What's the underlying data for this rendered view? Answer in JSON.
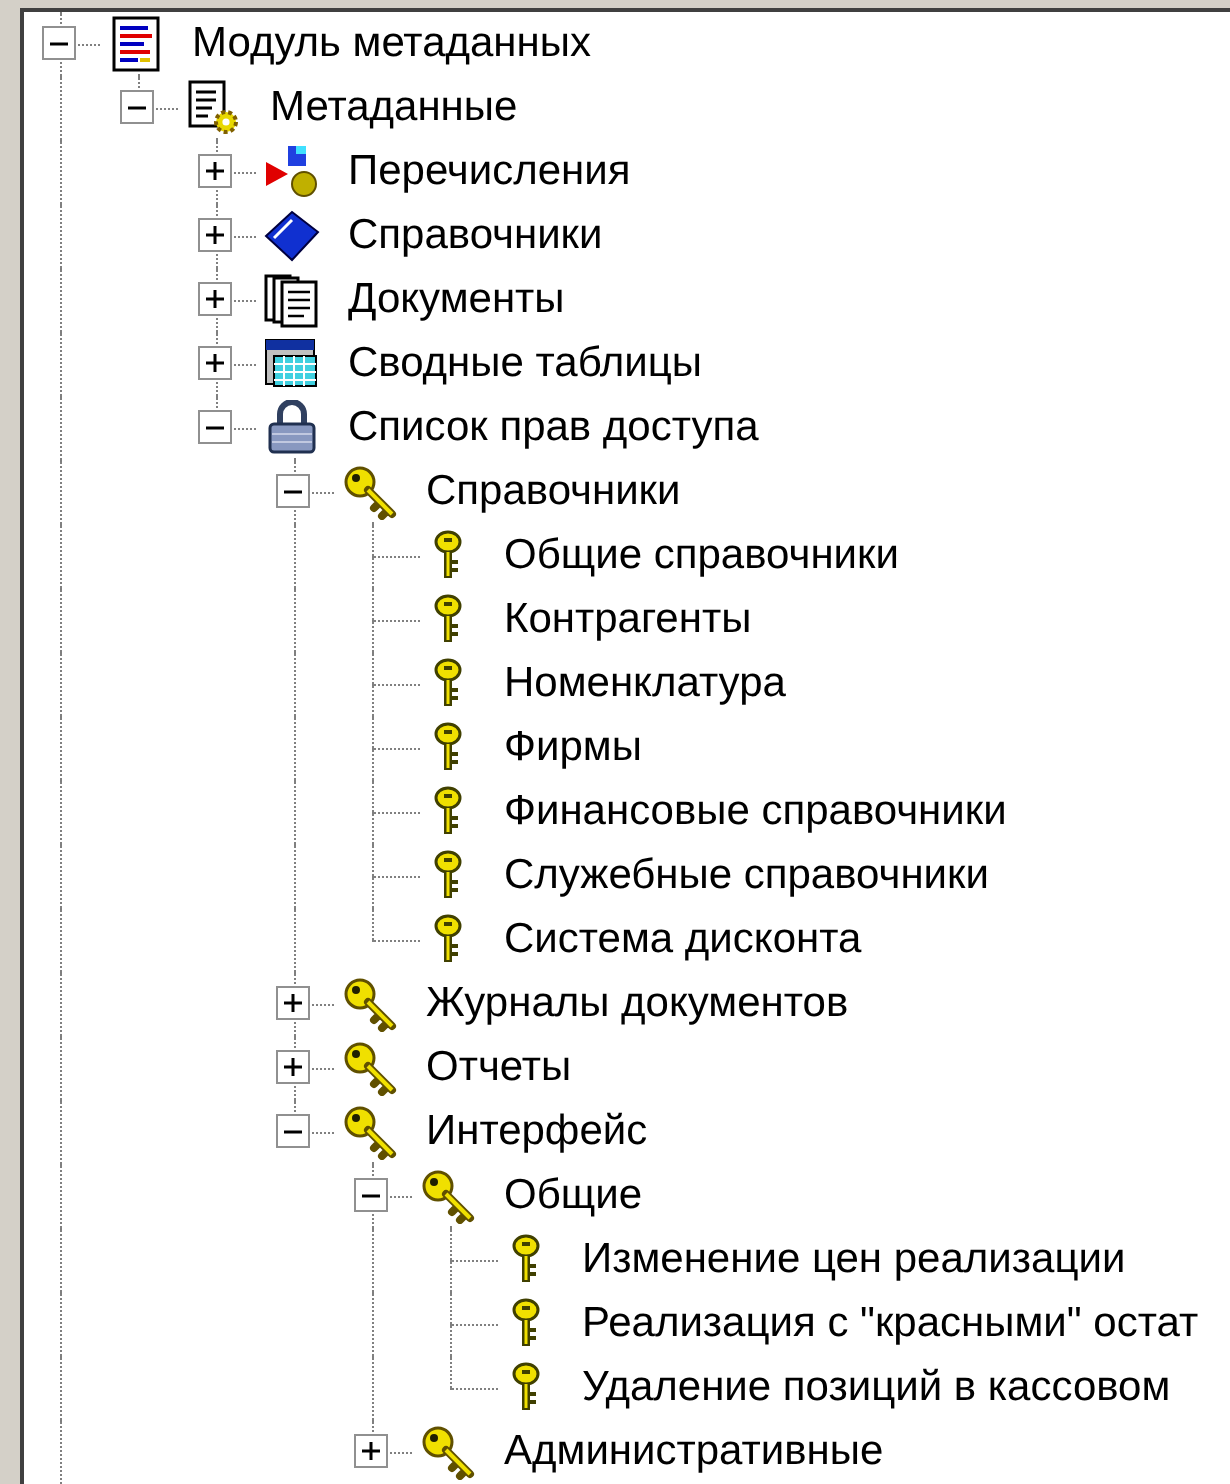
{
  "tree": [
    {
      "label": "Модуль метаданных",
      "kind": "module",
      "expanded": true,
      "children": [
        {
          "label": "Метаданные",
          "kind": "metadata",
          "expanded": true,
          "children": [
            {
              "label": "Перечисления",
              "kind": "enum",
              "expanded": false
            },
            {
              "label": "Справочники",
              "kind": "catalog",
              "expanded": false
            },
            {
              "label": "Документы",
              "kind": "documents",
              "expanded": false
            },
            {
              "label": "Сводные таблицы",
              "kind": "table",
              "expanded": false
            },
            {
              "label": "Список прав доступа",
              "kind": "lock",
              "expanded": true,
              "children": [
                {
                  "label": "Справочники",
                  "kind": "key",
                  "expanded": true,
                  "children": [
                    {
                      "label": "Общие справочники",
                      "kind": "small-key"
                    },
                    {
                      "label": "Контрагенты",
                      "kind": "small-key"
                    },
                    {
                      "label": "Номенклатура",
                      "kind": "small-key"
                    },
                    {
                      "label": "Фирмы",
                      "kind": "small-key"
                    },
                    {
                      "label": "Финансовые справочники",
                      "kind": "small-key"
                    },
                    {
                      "label": "Служебные справочники",
                      "kind": "small-key"
                    },
                    {
                      "label": "Система дисконта",
                      "kind": "small-key"
                    }
                  ]
                },
                {
                  "label": "Журналы документов",
                  "kind": "key",
                  "expanded": false
                },
                {
                  "label": "Отчеты",
                  "kind": "key",
                  "expanded": false
                },
                {
                  "label": "Интерфейс",
                  "kind": "key",
                  "expanded": true,
                  "children": [
                    {
                      "label": "Общие",
                      "kind": "key",
                      "expanded": true,
                      "children": [
                        {
                          "label": "Изменение цен реализации",
                          "kind": "small-key"
                        },
                        {
                          "label": "Реализация с \"красными\" остат",
                          "kind": "small-key"
                        },
                        {
                          "label": "Удаление позиций в кассовом",
                          "kind": "small-key"
                        }
                      ]
                    },
                    {
                      "label": "Административные",
                      "kind": "key",
                      "expanded": false
                    }
                  ]
                }
              ]
            }
          ]
        }
      ]
    }
  ]
}
